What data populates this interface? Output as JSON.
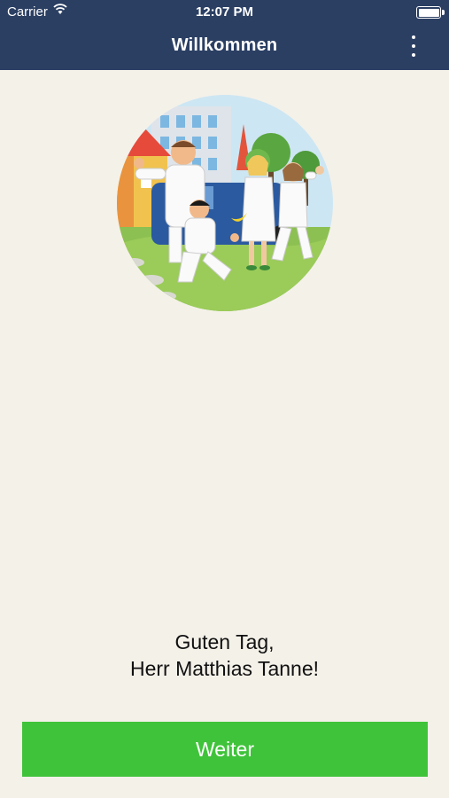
{
  "status_bar": {
    "carrier": "Carrier",
    "time": "12:07 PM",
    "wifi_icon": "wifi-icon",
    "battery_icon": "battery-icon"
  },
  "nav": {
    "title": "Willkommen",
    "menu_icon": "more-vertical-icon"
  },
  "illustration": {
    "description_icon": "welcome-team-illustration"
  },
  "greeting": {
    "line1": "Guten Tag,",
    "line2": "Herr Matthias Tanne!"
  },
  "button": {
    "label": "Weiter"
  },
  "colors": {
    "navbar": "#2b3f63",
    "background": "#f4f1e9",
    "button": "#3fc33a"
  }
}
